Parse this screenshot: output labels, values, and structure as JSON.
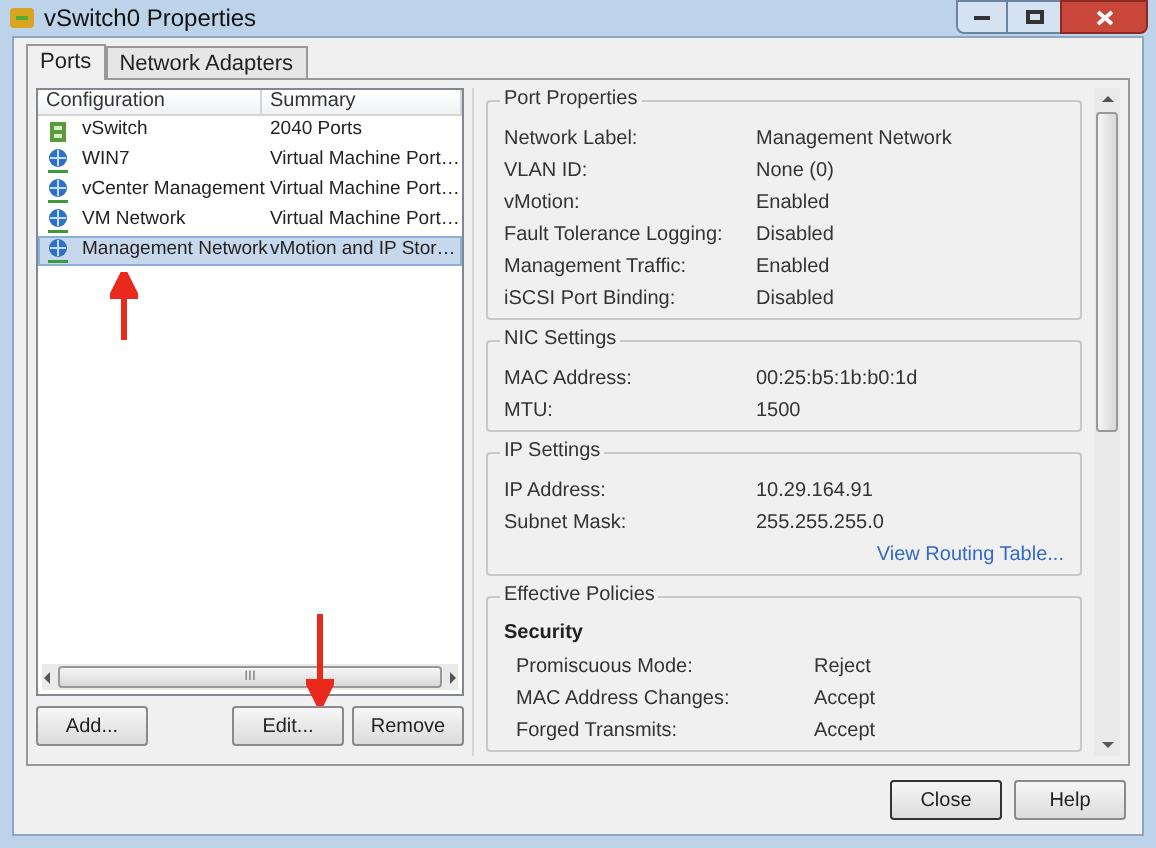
{
  "window": {
    "title": "vSwitch0 Properties"
  },
  "tabs": [
    {
      "label": "Ports",
      "selected": true
    },
    {
      "label": "Network Adapters",
      "selected": false
    }
  ],
  "list": {
    "columns": [
      "Configuration",
      "Summary"
    ],
    "rows": [
      {
        "kind": "switch",
        "name": "vSwitch",
        "summary": "2040 Ports",
        "selected": false
      },
      {
        "kind": "port",
        "name": "WIN7",
        "summary": "Virtual Machine Port…",
        "selected": false
      },
      {
        "kind": "port",
        "name": "vCenter Management",
        "summary": "Virtual Machine Port…",
        "selected": false
      },
      {
        "kind": "port",
        "name": "VM Network",
        "summary": "Virtual Machine Port…",
        "selected": false
      },
      {
        "kind": "port",
        "name": "Management Network",
        "summary": "vMotion and IP Stor…",
        "selected": true
      }
    ],
    "scroll_grip": "III"
  },
  "list_buttons": [
    "Add...",
    "Edit...",
    "Remove"
  ],
  "groups": [
    {
      "title": "Port Properties",
      "rows": [
        {
          "label": "Network Label:",
          "value": "Management Network"
        },
        {
          "label": "VLAN ID:",
          "value": "None (0)"
        },
        {
          "label": "vMotion:",
          "value": "Enabled"
        },
        {
          "label": "Fault Tolerance Logging:",
          "value": "Disabled"
        },
        {
          "label": "Management Traffic:",
          "value": "Enabled"
        },
        {
          "label": "iSCSI Port Binding:",
          "value": "Disabled"
        }
      ]
    },
    {
      "title": "NIC Settings",
      "rows": [
        {
          "label": "MAC Address:",
          "value": "00:25:b5:1b:b0:1d"
        },
        {
          "label": "MTU:",
          "value": "1500"
        }
      ]
    },
    {
      "title": "IP Settings",
      "rows": [
        {
          "label": "IP Address:",
          "value": "10.29.164.91"
        },
        {
          "label": "Subnet Mask:",
          "value": "255.255.255.0"
        }
      ],
      "link": "View Routing Table..."
    }
  ],
  "policies": {
    "title": "Effective Policies",
    "section": "Security",
    "rows": [
      {
        "label": "Promiscuous Mode:",
        "value": "Reject"
      },
      {
        "label": "MAC Address Changes:",
        "value": "Accept"
      },
      {
        "label": "Forged Transmits:",
        "value": "Accept"
      }
    ]
  },
  "dialog_buttons": [
    "Close",
    "Help"
  ]
}
